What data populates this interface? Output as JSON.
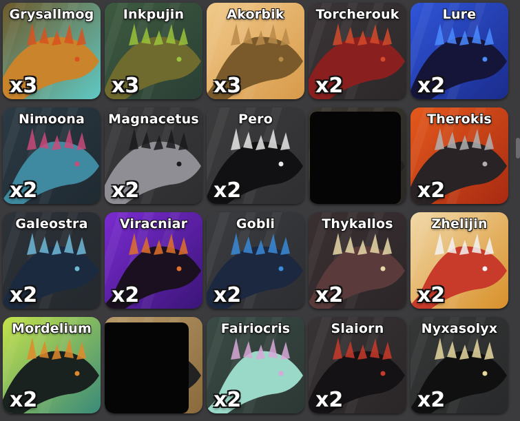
{
  "cards": [
    {
      "name": "Grysallmog",
      "count": "x3",
      "bg1": "#6e5a2a",
      "bg2": "#5fc9c4",
      "creature": "#c9842c",
      "accent": "#d8521f"
    },
    {
      "name": "Inkpujin",
      "count": "x3",
      "bg1": "#3d5a3f",
      "bg2": "#2a3f35",
      "creature": "#6f6a2e",
      "accent": "#9ac23a"
    },
    {
      "name": "Akorbik",
      "count": "x3",
      "bg1": "#f0c98a",
      "bg2": "#d89a4a",
      "creature": "#7a5a2a",
      "accent": "#b88a4a"
    },
    {
      "name": "Torcherouk",
      "count": "x2",
      "bg1": "#3a3436",
      "bg2": "#2c2829",
      "creature": "#8a1f1f",
      "accent": "#d24a2a"
    },
    {
      "name": "Lure",
      "count": "x2",
      "bg1": "#2f55d8",
      "bg2": "#1b2c8c",
      "creature": "#15153a",
      "accent": "#4a8aff"
    },
    {
      "name": "Nimoona",
      "count": "x2",
      "bg1": "#2c3a44",
      "bg2": "#1f2a31",
      "creature": "#3f8aa0",
      "accent": "#c94a7a"
    },
    {
      "name": "Magnacetus",
      "count": "x2",
      "bg1": "#3a3a3c",
      "bg2": "#2e2e30",
      "creature": "#8e8e94",
      "accent": "#1a1a1c"
    },
    {
      "name": "Pero",
      "count": "x2",
      "bg1": "#3c3c3e",
      "bg2": "#2f2f31",
      "creature": "#111114",
      "accent": "#e8e8e8"
    },
    {
      "name": "",
      "count": "",
      "bg1": "#3a3630",
      "bg2": "#2c2925",
      "creature": "#222",
      "accent": "#111",
      "redacted": true
    },
    {
      "name": "Therokis",
      "count": "x2",
      "bg1": "#e4591c",
      "bg2": "#a82a12",
      "creature": "#2a2325",
      "accent": "#b0b0b0"
    },
    {
      "name": "Galeostra",
      "count": "x2",
      "bg1": "#2d3238",
      "bg2": "#24292e",
      "creature": "#1c2a40",
      "accent": "#6fb8d8"
    },
    {
      "name": "Viracniar",
      "count": "x2",
      "bg1": "#7a2bd0",
      "bg2": "#3b1578",
      "creature": "#1a1020",
      "accent": "#e0702a"
    },
    {
      "name": "Gobli",
      "count": "x2",
      "bg1": "#3a3c40",
      "bg2": "#2c2e31",
      "creature": "#1c2840",
      "accent": "#3a8ad8"
    },
    {
      "name": "Thykallos",
      "count": "x2",
      "bg1": "#3a3032",
      "bg2": "#2c2628",
      "creature": "#5a3a3a",
      "accent": "#e8d8a8"
    },
    {
      "name": "Zhelijin",
      "count": "x2",
      "bg1": "#f1d9a8",
      "bg2": "#d8902a",
      "creature": "#c83a2a",
      "accent": "#f2f2f2"
    },
    {
      "name": "Mordelium",
      "count": "x2",
      "bg1": "#c4e24a",
      "bg2": "#3a8a7a",
      "creature": "#1a2220",
      "accent": "#e08a2a"
    },
    {
      "name": "",
      "count": "",
      "bg1": "#b89a6a",
      "bg2": "#8a6a3a",
      "creature": "#222",
      "accent": "#111",
      "redacted": true
    },
    {
      "name": "Fairiocris",
      "count": "x2",
      "bg1": "#3a4a44",
      "bg2": "#2c3834",
      "creature": "#9ad8c8",
      "accent": "#d8a8d8"
    },
    {
      "name": "Slaiorn",
      "count": "x2",
      "bg1": "#383436",
      "bg2": "#2a2628",
      "creature": "#141214",
      "accent": "#c83a2a"
    },
    {
      "name": "Nyxasolyx",
      "count": "x2",
      "bg1": "#363838",
      "bg2": "#28292a",
      "creature": "#101010",
      "accent": "#e8d8a0"
    }
  ]
}
